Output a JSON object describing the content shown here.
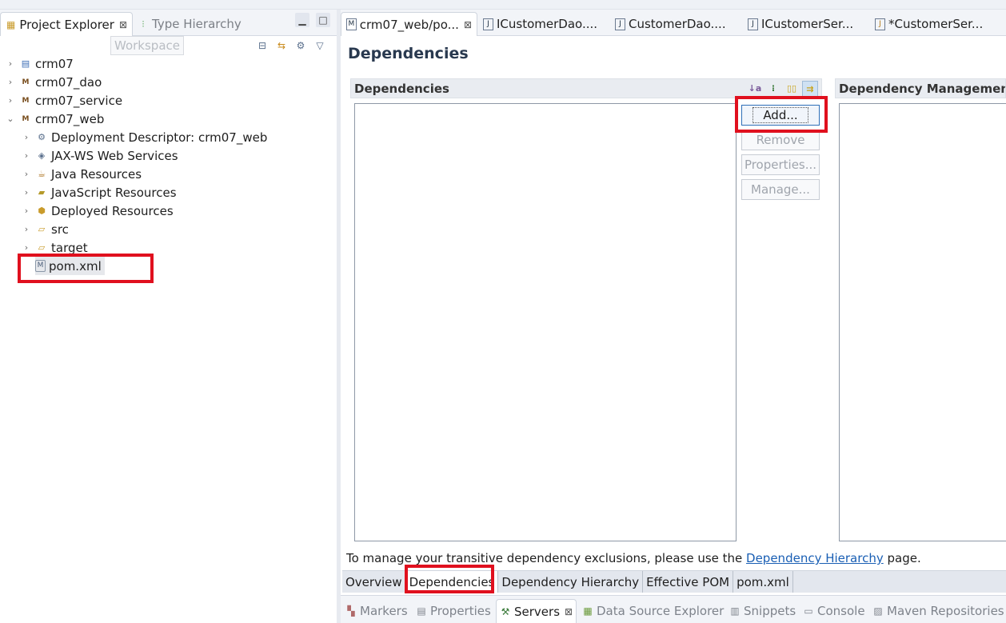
{
  "left_pane": {
    "tabs": [
      {
        "label": "Project Explorer",
        "close": "⊠"
      },
      {
        "label": "Type Hierarchy"
      }
    ],
    "tooltip": "Workspace",
    "tree": [
      {
        "label": "crm07"
      },
      {
        "label": "crm07_dao"
      },
      {
        "label": "crm07_service"
      },
      {
        "label": "crm07_web"
      },
      {
        "label": "Deployment Descriptor: crm07_web"
      },
      {
        "label": "JAX-WS Web Services"
      },
      {
        "label": "Java Resources"
      },
      {
        "label": "JavaScript Resources"
      },
      {
        "label": "Deployed Resources"
      },
      {
        "label": "src"
      },
      {
        "label": "target"
      },
      {
        "label": "pom.xml"
      }
    ]
  },
  "editor": {
    "tabs": [
      {
        "label": "crm07_web/po...",
        "close": "⊠"
      },
      {
        "label": "ICustomerDao...."
      },
      {
        "label": "CustomerDao...."
      },
      {
        "label": "ICustomerSer..."
      },
      {
        "label": "*CustomerSer..."
      }
    ],
    "page_title": "Dependencies",
    "dependencies_section": "Dependencies",
    "management_section": "Dependency Management",
    "buttons": {
      "add": "Add...",
      "remove": "Remove",
      "properties": "Properties...",
      "manage": "Manage..."
    },
    "info": {
      "prefix": "To manage your transitive dependency exclusions, please use the ",
      "link": "Dependency Hierarchy",
      "suffix": " page."
    },
    "page_tabs": [
      "Overview",
      "Dependencies",
      "Dependency Hierarchy",
      "Effective POM",
      "pom.xml"
    ]
  },
  "bottom_panel": {
    "tabs": [
      {
        "label": "Markers"
      },
      {
        "label": "Properties"
      },
      {
        "label": "Servers",
        "close": "⊠"
      },
      {
        "label": "Data Source Explorer"
      },
      {
        "label": "Snippets"
      },
      {
        "label": "Console"
      },
      {
        "label": "Maven Repositories"
      }
    ]
  },
  "colors": {
    "highlight_box": "#e0101e",
    "link": "#1a5fb4"
  }
}
